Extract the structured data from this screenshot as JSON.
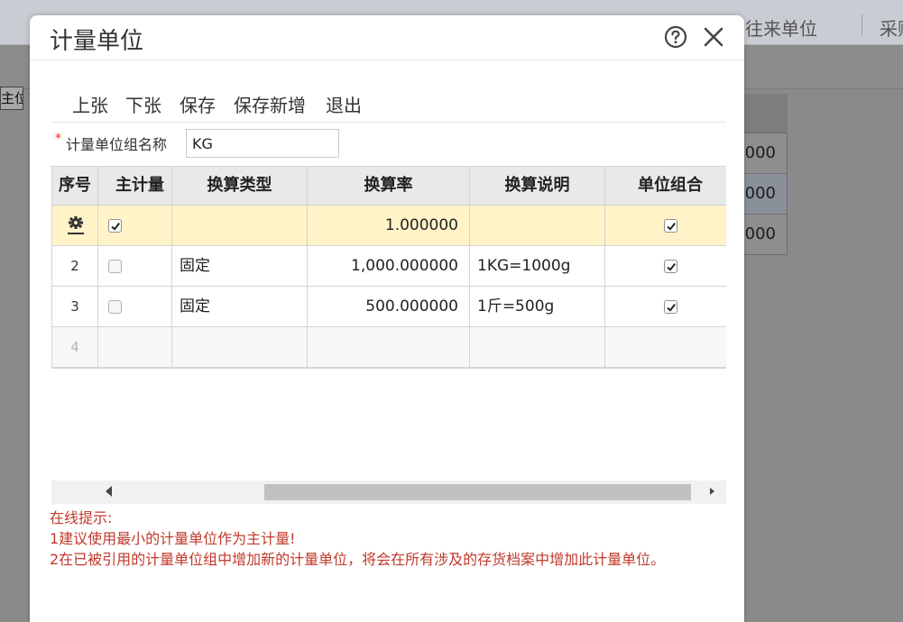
{
  "background": {
    "tabs": [
      {
        "label": "往来单位"
      },
      {
        "label": "采购"
      }
    ],
    "chip_label": "主位",
    "table_values": [
      "000",
      "000",
      "000"
    ]
  },
  "dialog": {
    "title": "计量单位",
    "toolbar": {
      "prev": "上张",
      "next": "下张",
      "save": "保存",
      "save_new": "保存新增",
      "exit": "退出"
    },
    "form": {
      "label": "计量单位组名称",
      "value": "KG"
    },
    "grid": {
      "columns": [
        "序号",
        "主计量",
        "换算类型",
        "换算率",
        "换算说明",
        "单位组合"
      ],
      "rows": [
        {
          "seq": "",
          "main": true,
          "type": "",
          "rate": "1.000000",
          "desc": "",
          "combo": true
        },
        {
          "seq": "2",
          "main": false,
          "type": "固定",
          "rate": "1,000.000000",
          "desc": "1KG=1000g",
          "combo": true
        },
        {
          "seq": "3",
          "main": false,
          "type": "固定",
          "rate": "500.000000",
          "desc": "1斤=500g",
          "combo": true
        },
        {
          "seq": "4",
          "main": null,
          "type": "",
          "rate": "",
          "desc": "",
          "combo": null
        }
      ]
    },
    "hints": {
      "title": "在线提示:",
      "line1": "1建议使用最小的计量单位作为主计量!",
      "line2": "2在已被引用的计量单位组中增加新的计量单位，将会在所有涉及的存货档案中增加此计量单位。"
    }
  },
  "colors": {
    "active_row": "#fff3c7",
    "hint_red": "#c0392b",
    "required_star": "#e0321d"
  }
}
